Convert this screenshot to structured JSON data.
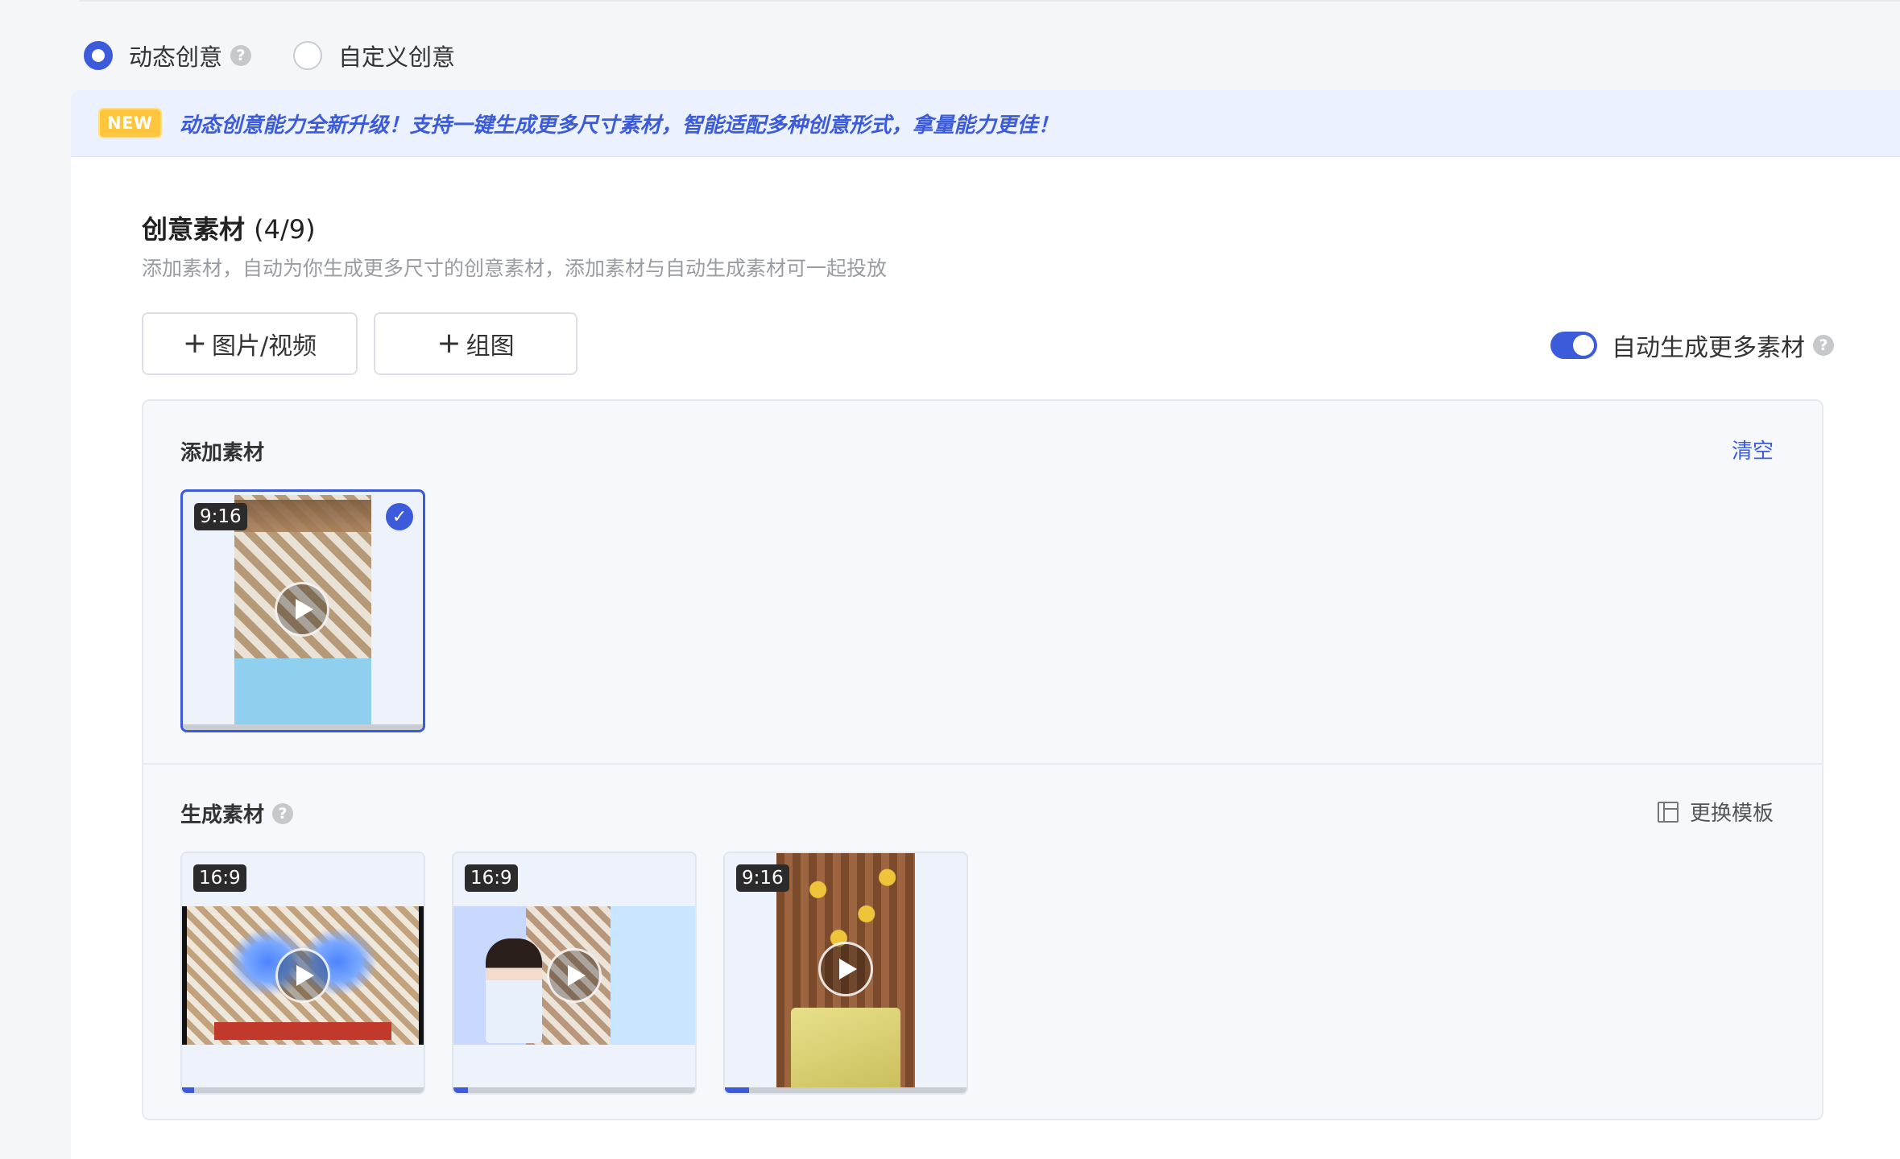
{
  "creative_mode": {
    "options": [
      {
        "label": "动态创意",
        "checked": true,
        "help_icon": "question-circle-icon"
      },
      {
        "label": "自定义创意",
        "checked": false
      }
    ]
  },
  "banner": {
    "badge": "NEW",
    "text": "动态创意能力全新升级！支持一键生成更多尺寸素材，智能适配多种创意形式，拿量能力更佳！"
  },
  "creative_assets": {
    "title": "创意素材",
    "count": "(4/9)",
    "description": "添加素材，自动为你生成更多尺寸的创意素材，添加素材与自动生成素材可一起投放"
  },
  "buttons": {
    "add_image_video": "图片/视频",
    "add_group": "组图",
    "plus_glyph": "+"
  },
  "auto_generate": {
    "label": "自动生成更多素材",
    "enabled": true
  },
  "added_materials": {
    "title": "添加素材",
    "clear_label": "清空",
    "items": [
      {
        "ratio": "9:16",
        "selected": true,
        "icon": "play-icon",
        "check_glyph": "✓"
      }
    ]
  },
  "generated_materials": {
    "title": "生成素材",
    "change_template_label": "更换模板",
    "items": [
      {
        "ratio": "16:9",
        "icon": "play-icon"
      },
      {
        "ratio": "16:9",
        "icon": "play-icon"
      },
      {
        "ratio": "9:16",
        "icon": "play-icon"
      }
    ]
  },
  "colors": {
    "accent": "#3b5bdb",
    "badge": "#ffc53d",
    "banner_bg": "#ebf1ff"
  }
}
